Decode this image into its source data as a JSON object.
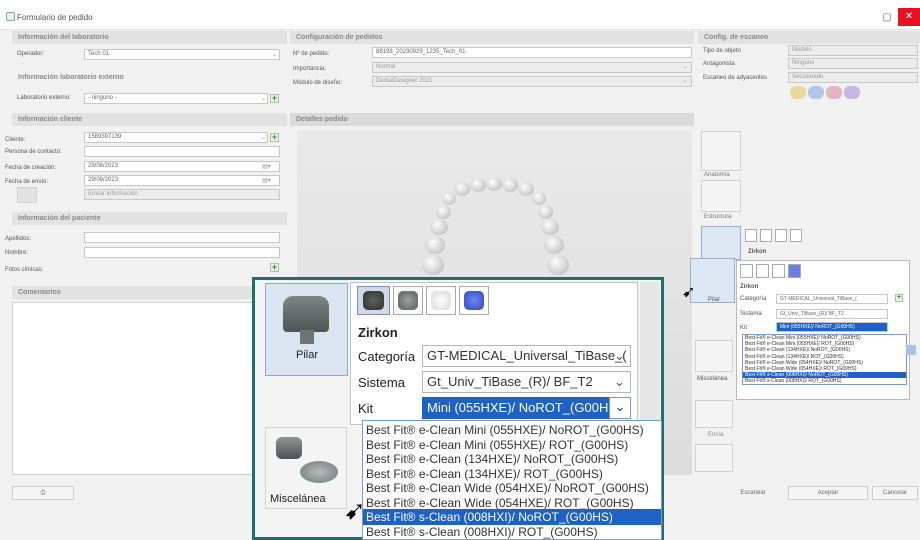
{
  "window": {
    "title": "Formulario de pedido",
    "restore_glyph": "▢",
    "close_glyph": "✕"
  },
  "lab": {
    "header": "Información del laboratorio",
    "operator_label": "Operador:",
    "operator_value": "Tech 01",
    "ext_header": "Información laboratorio externo",
    "ext_label": "Laboratorio externo:",
    "ext_value": "- ninguno -"
  },
  "client": {
    "header": "Información cliente",
    "client_label": "Cliente:",
    "client_value": "1589397139",
    "contact_label": "Persona de contacto:",
    "created_label": "Fecha de creación:",
    "created_value": "29/08/2023",
    "sent_label": "Fecha de envío:",
    "sent_value": "29/08/2023",
    "send_info_label": "Enviar información"
  },
  "patient": {
    "header": "Información del paciente",
    "last_name_label": "Apellidos:",
    "first_name_label": "Nombre:",
    "photos_label": "Fotos clínicas:"
  },
  "comments": {
    "header": "Comentarios"
  },
  "order": {
    "header": "Configuración de pedidos",
    "number_label": "Nº de pedido:",
    "number_value": "88198_20230829_1235_Tech_01",
    "importance_label": "Importancia:",
    "importance_value": "Normal",
    "module_label": "Módulo de diseño:",
    "module_value": "DentalDesigner 2021"
  },
  "details": {
    "header": "Detalles pedido"
  },
  "scan": {
    "header": "Config. de escaneo",
    "object_type_label": "Tipo de objeto",
    "object_type_value": "Modelo",
    "antagonist_label": "Antagonista",
    "antagonist_value": "Ninguno",
    "adjacent_label": "Escaneo de adyacentes",
    "adjacent_value": "Seccionado"
  },
  "sidebar": {
    "anatomy": "Anatomía",
    "structure": "Estructura",
    "pilar": "Pilar",
    "misc": "Miscelánea",
    "gum": "Encía"
  },
  "material": {
    "name": "Zirkon",
    "category_label": "Categoría",
    "category_value": "GT-MEDICAL_Universal_TiBase_(",
    "system_label": "Sistema",
    "system_value": "Gt_Univ_TiBase_(R)/ BF_T2",
    "kit_label": "Kit",
    "kit_value": "Mini (055HXE)/ NoROT_(G00HS)"
  },
  "kit_options": [
    "Best Fit® e-Clean Mini (055HXE)/ NoROT_(G00HS)",
    "Best Fit® e-Clean Mini (055HXE)/ ROT_(G00HS)",
    "Best Fit® e-Clean (134HXE)/ NoROT_(G00HS)",
    "Best Fit® e-Clean (134HXE)/ ROT_(G00HS)",
    "Best Fit® e-Clean Wide (054HXE)/ NoROT_(G00HS)",
    "Best Fit® e-Clean Wide (054HXE)/ ROT_(G00HS)",
    "Best Fit® s-Clean (008HXI)/ NoROT_(G00HS)",
    "Best Fit® s-Clean (008HXI)/ ROT_(G00HS)"
  ],
  "kit_selected_index": 6,
  "footer": {
    "scan": "Escanear",
    "accept": "Aceptar",
    "cancel": "Cancelar"
  }
}
